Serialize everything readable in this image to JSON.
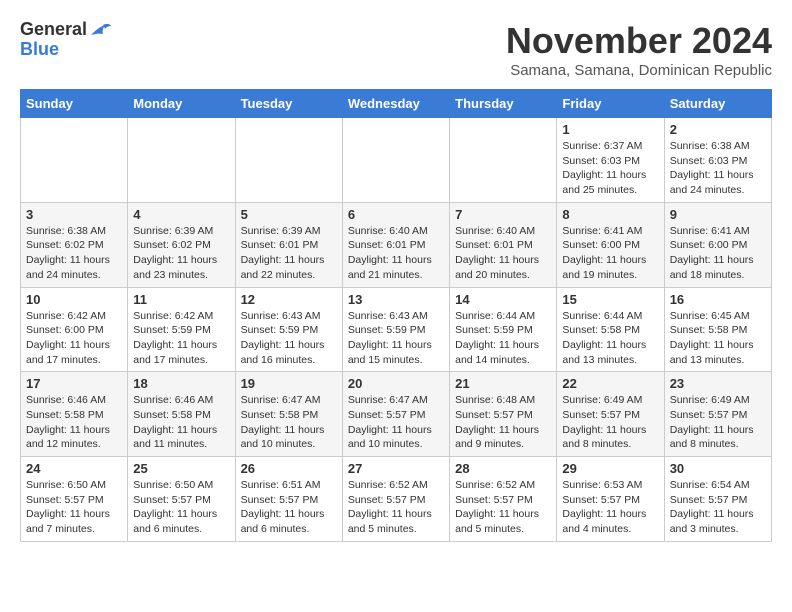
{
  "header": {
    "logo_general": "General",
    "logo_blue": "Blue",
    "month_title": "November 2024",
    "location": "Samana, Samana, Dominican Republic"
  },
  "days_of_week": [
    "Sunday",
    "Monday",
    "Tuesday",
    "Wednesday",
    "Thursday",
    "Friday",
    "Saturday"
  ],
  "weeks": [
    [
      {
        "day": "",
        "info": ""
      },
      {
        "day": "",
        "info": ""
      },
      {
        "day": "",
        "info": ""
      },
      {
        "day": "",
        "info": ""
      },
      {
        "day": "",
        "info": ""
      },
      {
        "day": "1",
        "info": "Sunrise: 6:37 AM\nSunset: 6:03 PM\nDaylight: 11 hours and 25 minutes."
      },
      {
        "day": "2",
        "info": "Sunrise: 6:38 AM\nSunset: 6:03 PM\nDaylight: 11 hours and 24 minutes."
      }
    ],
    [
      {
        "day": "3",
        "info": "Sunrise: 6:38 AM\nSunset: 6:02 PM\nDaylight: 11 hours and 24 minutes."
      },
      {
        "day": "4",
        "info": "Sunrise: 6:39 AM\nSunset: 6:02 PM\nDaylight: 11 hours and 23 minutes."
      },
      {
        "day": "5",
        "info": "Sunrise: 6:39 AM\nSunset: 6:01 PM\nDaylight: 11 hours and 22 minutes."
      },
      {
        "day": "6",
        "info": "Sunrise: 6:40 AM\nSunset: 6:01 PM\nDaylight: 11 hours and 21 minutes."
      },
      {
        "day": "7",
        "info": "Sunrise: 6:40 AM\nSunset: 6:01 PM\nDaylight: 11 hours and 20 minutes."
      },
      {
        "day": "8",
        "info": "Sunrise: 6:41 AM\nSunset: 6:00 PM\nDaylight: 11 hours and 19 minutes."
      },
      {
        "day": "9",
        "info": "Sunrise: 6:41 AM\nSunset: 6:00 PM\nDaylight: 11 hours and 18 minutes."
      }
    ],
    [
      {
        "day": "10",
        "info": "Sunrise: 6:42 AM\nSunset: 6:00 PM\nDaylight: 11 hours and 17 minutes."
      },
      {
        "day": "11",
        "info": "Sunrise: 6:42 AM\nSunset: 5:59 PM\nDaylight: 11 hours and 17 minutes."
      },
      {
        "day": "12",
        "info": "Sunrise: 6:43 AM\nSunset: 5:59 PM\nDaylight: 11 hours and 16 minutes."
      },
      {
        "day": "13",
        "info": "Sunrise: 6:43 AM\nSunset: 5:59 PM\nDaylight: 11 hours and 15 minutes."
      },
      {
        "day": "14",
        "info": "Sunrise: 6:44 AM\nSunset: 5:59 PM\nDaylight: 11 hours and 14 minutes."
      },
      {
        "day": "15",
        "info": "Sunrise: 6:44 AM\nSunset: 5:58 PM\nDaylight: 11 hours and 13 minutes."
      },
      {
        "day": "16",
        "info": "Sunrise: 6:45 AM\nSunset: 5:58 PM\nDaylight: 11 hours and 13 minutes."
      }
    ],
    [
      {
        "day": "17",
        "info": "Sunrise: 6:46 AM\nSunset: 5:58 PM\nDaylight: 11 hours and 12 minutes."
      },
      {
        "day": "18",
        "info": "Sunrise: 6:46 AM\nSunset: 5:58 PM\nDaylight: 11 hours and 11 minutes."
      },
      {
        "day": "19",
        "info": "Sunrise: 6:47 AM\nSunset: 5:58 PM\nDaylight: 11 hours and 10 minutes."
      },
      {
        "day": "20",
        "info": "Sunrise: 6:47 AM\nSunset: 5:57 PM\nDaylight: 11 hours and 10 minutes."
      },
      {
        "day": "21",
        "info": "Sunrise: 6:48 AM\nSunset: 5:57 PM\nDaylight: 11 hours and 9 minutes."
      },
      {
        "day": "22",
        "info": "Sunrise: 6:49 AM\nSunset: 5:57 PM\nDaylight: 11 hours and 8 minutes."
      },
      {
        "day": "23",
        "info": "Sunrise: 6:49 AM\nSunset: 5:57 PM\nDaylight: 11 hours and 8 minutes."
      }
    ],
    [
      {
        "day": "24",
        "info": "Sunrise: 6:50 AM\nSunset: 5:57 PM\nDaylight: 11 hours and 7 minutes."
      },
      {
        "day": "25",
        "info": "Sunrise: 6:50 AM\nSunset: 5:57 PM\nDaylight: 11 hours and 6 minutes."
      },
      {
        "day": "26",
        "info": "Sunrise: 6:51 AM\nSunset: 5:57 PM\nDaylight: 11 hours and 6 minutes."
      },
      {
        "day": "27",
        "info": "Sunrise: 6:52 AM\nSunset: 5:57 PM\nDaylight: 11 hours and 5 minutes."
      },
      {
        "day": "28",
        "info": "Sunrise: 6:52 AM\nSunset: 5:57 PM\nDaylight: 11 hours and 5 minutes."
      },
      {
        "day": "29",
        "info": "Sunrise: 6:53 AM\nSunset: 5:57 PM\nDaylight: 11 hours and 4 minutes."
      },
      {
        "day": "30",
        "info": "Sunrise: 6:54 AM\nSunset: 5:57 PM\nDaylight: 11 hours and 3 minutes."
      }
    ]
  ]
}
